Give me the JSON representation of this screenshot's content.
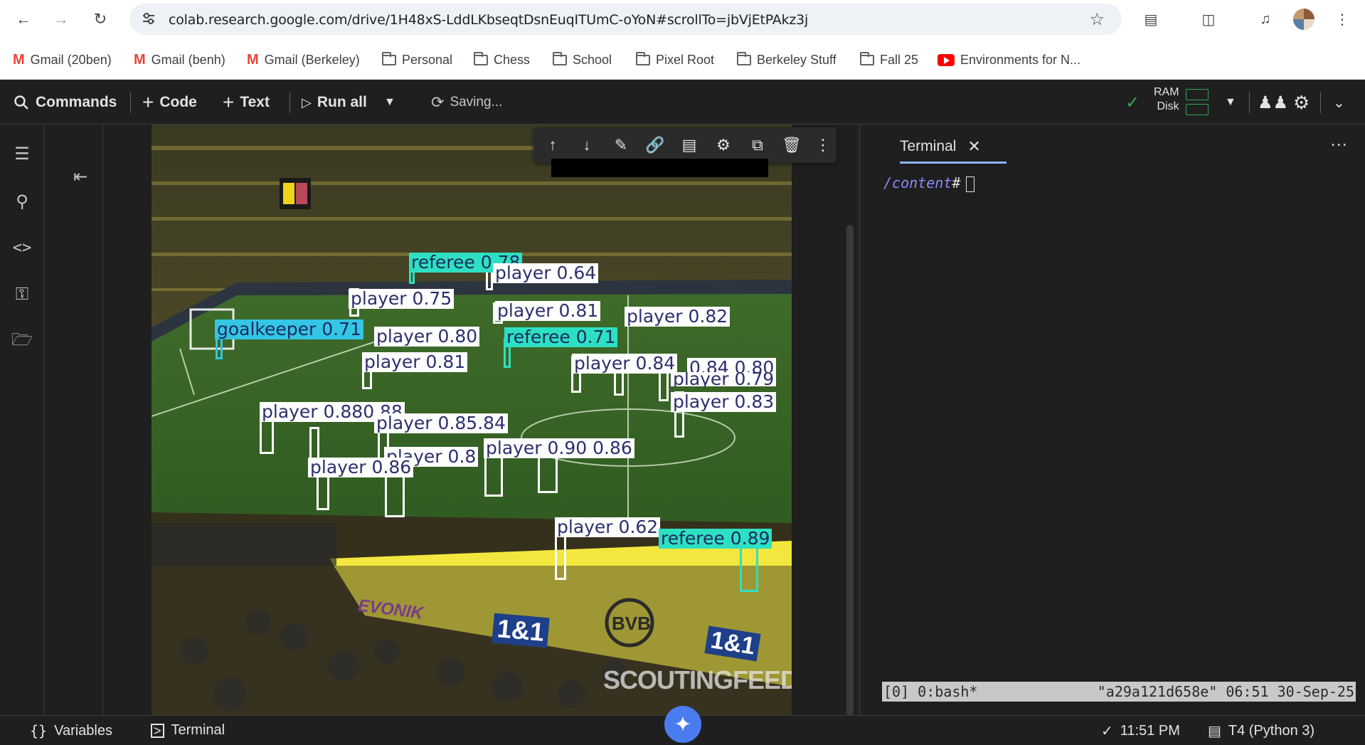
{
  "browser": {
    "url": "colab.research.google.com/drive/1H48xS-LddLKbseqtDsnEuqITUmC-oYoN#scrollTo=jbVjEtPAkz3j"
  },
  "bookmarks": [
    {
      "label": "Gmail (20ben)",
      "icon": "gmail-icon"
    },
    {
      "label": "Gmail (benh)",
      "icon": "gmail-icon"
    },
    {
      "label": "Gmail (Berkeley)",
      "icon": "gmail-icon"
    },
    {
      "label": "Personal",
      "icon": "folder-icon"
    },
    {
      "label": "Chess",
      "icon": "folder-icon"
    },
    {
      "label": "School",
      "icon": "folder-icon"
    },
    {
      "label": "Pixel Root",
      "icon": "folder-icon"
    },
    {
      "label": "Berkeley Stuff",
      "icon": "folder-icon"
    },
    {
      "label": "Fall 25",
      "icon": "folder-icon"
    },
    {
      "label": "Environments for N...",
      "icon": "youtube-icon"
    }
  ],
  "toolbar": {
    "commands": "Commands",
    "code": "Code",
    "text": "Text",
    "run_all": "Run all",
    "saving": "Saving...",
    "ram": "RAM",
    "disk": "Disk"
  },
  "image": {
    "detections": [
      {
        "label": "referee 0.78",
        "kind": "ref"
      },
      {
        "label": "player 0.64",
        "kind": "player"
      },
      {
        "label": "player 0.75",
        "kind": "player"
      },
      {
        "label": "player 0.81",
        "kind": "player"
      },
      {
        "label": "player 0.82",
        "kind": "player"
      },
      {
        "label": "goalkeeper 0.71",
        "kind": "gk"
      },
      {
        "label": "player 0.80",
        "kind": "player"
      },
      {
        "label": "referee 0.71",
        "kind": "ref"
      },
      {
        "label": "player 0.81",
        "kind": "player"
      },
      {
        "label": "player 0.84",
        "kind": "player"
      },
      {
        "label": "0.84 0.80",
        "kind": "player"
      },
      {
        "label": "player 0.79",
        "kind": "player"
      },
      {
        "label": "player 0.83",
        "kind": "player"
      },
      {
        "label": "player 0.880.88",
        "kind": "player"
      },
      {
        "label": "player 0.85.84",
        "kind": "player"
      },
      {
        "label": "player 0.90 0.86",
        "kind": "player"
      },
      {
        "label": "player 0.8",
        "kind": "player"
      },
      {
        "label": "player 0.86",
        "kind": "player"
      },
      {
        "label": "player 0.62",
        "kind": "player"
      },
      {
        "label": "referee 0.89",
        "kind": "ref"
      }
    ],
    "stadium_signage": [
      "EVONIK",
      "1&1",
      "BVB",
      "1&1",
      "SCOUTINGFEED"
    ]
  },
  "terminal": {
    "tab_label": "Terminal",
    "prompt_path": "/content",
    "prompt_symbol": "#",
    "tmux_left": "[0] 0:bash*",
    "tmux_right": "\"a29a121d658e\" 06:51 30-Sep-25"
  },
  "statusbar": {
    "variables": "Variables",
    "terminal": "Terminal",
    "time": "11:51 PM",
    "runtime": "T4 (Python 3)"
  },
  "colors": {
    "player_label": "#ffffff",
    "referee_label": "#2ee0c2",
    "goalkeeper_label": "#34c6e5",
    "pitch": "#3f6b2a",
    "accent": "#8ab4f8"
  }
}
